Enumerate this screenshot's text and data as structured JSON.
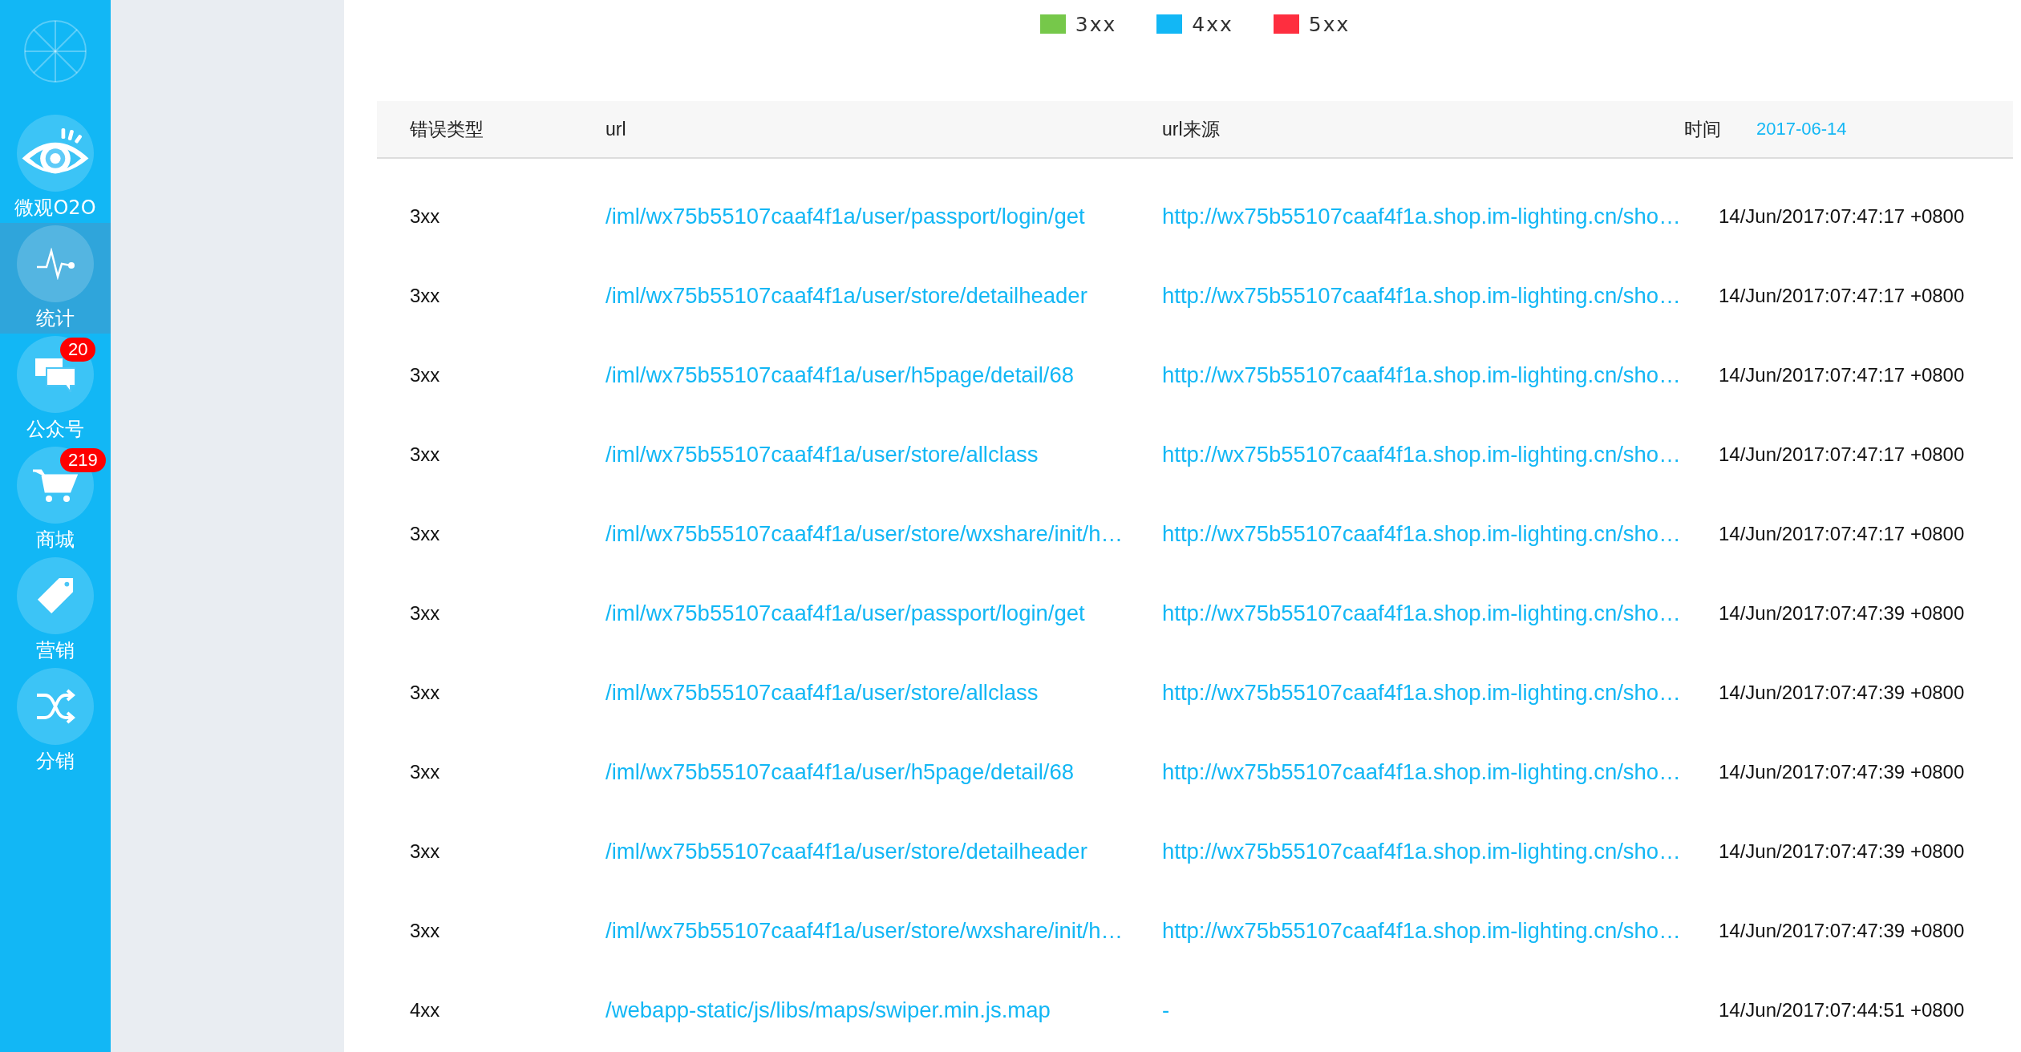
{
  "sidebar": {
    "items": [
      {
        "label": "微观O2O",
        "selected": false
      },
      {
        "label": "统计",
        "selected": true
      },
      {
        "label": "公众号",
        "selected": false,
        "badge": "20"
      },
      {
        "label": "商城",
        "selected": false,
        "badge": "219"
      },
      {
        "label": "营销",
        "selected": false
      },
      {
        "label": "分销",
        "selected": false
      }
    ]
  },
  "legend": [
    {
      "label": "3xx",
      "color": "#76c84a"
    },
    {
      "label": "4xx",
      "color": "#12b7f5"
    },
    {
      "label": "5xx",
      "color": "#fe2e3f"
    }
  ],
  "table": {
    "columns": [
      "错误类型",
      "url",
      "url来源",
      "时间"
    ],
    "date_filter": "2017-06-14",
    "rows": [
      {
        "type": "3xx",
        "url": "/iml/wx75b55107caaf4f1a/user/passport/login/get",
        "source": "http://wx75b55107caaf4f1a.shop.im-lighting.cn/sho…",
        "time": "14/Jun/2017:07:47:17 +0800"
      },
      {
        "type": "3xx",
        "url": "/iml/wx75b55107caaf4f1a/user/store/detailheader",
        "source": "http://wx75b55107caaf4f1a.shop.im-lighting.cn/sho…",
        "time": "14/Jun/2017:07:47:17 +0800"
      },
      {
        "type": "3xx",
        "url": "/iml/wx75b55107caaf4f1a/user/h5page/detail/68",
        "source": "http://wx75b55107caaf4f1a.shop.im-lighting.cn/sho…",
        "time": "14/Jun/2017:07:47:17 +0800"
      },
      {
        "type": "3xx",
        "url": "/iml/wx75b55107caaf4f1a/user/store/allclass",
        "source": "http://wx75b55107caaf4f1a.shop.im-lighting.cn/sho…",
        "time": "14/Jun/2017:07:47:17 +0800"
      },
      {
        "type": "3xx",
        "url": "/iml/wx75b55107caaf4f1a/user/store/wxshare/init/h…",
        "source": "http://wx75b55107caaf4f1a.shop.im-lighting.cn/sho…",
        "time": "14/Jun/2017:07:47:17 +0800"
      },
      {
        "type": "3xx",
        "url": "/iml/wx75b55107caaf4f1a/user/passport/login/get",
        "source": "http://wx75b55107caaf4f1a.shop.im-lighting.cn/sho…",
        "time": "14/Jun/2017:07:47:39 +0800"
      },
      {
        "type": "3xx",
        "url": "/iml/wx75b55107caaf4f1a/user/store/allclass",
        "source": "http://wx75b55107caaf4f1a.shop.im-lighting.cn/sho…",
        "time": "14/Jun/2017:07:47:39 +0800"
      },
      {
        "type": "3xx",
        "url": "/iml/wx75b55107caaf4f1a/user/h5page/detail/68",
        "source": "http://wx75b55107caaf4f1a.shop.im-lighting.cn/sho…",
        "time": "14/Jun/2017:07:47:39 +0800"
      },
      {
        "type": "3xx",
        "url": "/iml/wx75b55107caaf4f1a/user/store/detailheader",
        "source": "http://wx75b55107caaf4f1a.shop.im-lighting.cn/sho…",
        "time": "14/Jun/2017:07:47:39 +0800"
      },
      {
        "type": "3xx",
        "url": "/iml/wx75b55107caaf4f1a/user/store/wxshare/init/h…",
        "source": "http://wx75b55107caaf4f1a.shop.im-lighting.cn/sho…",
        "time": "14/Jun/2017:07:47:39 +0800"
      },
      {
        "type": "4xx",
        "url": "/webapp-static/js/libs/maps/swiper.min.js.map",
        "source": "-",
        "time": "14/Jun/2017:07:44:51 +0800"
      }
    ]
  }
}
